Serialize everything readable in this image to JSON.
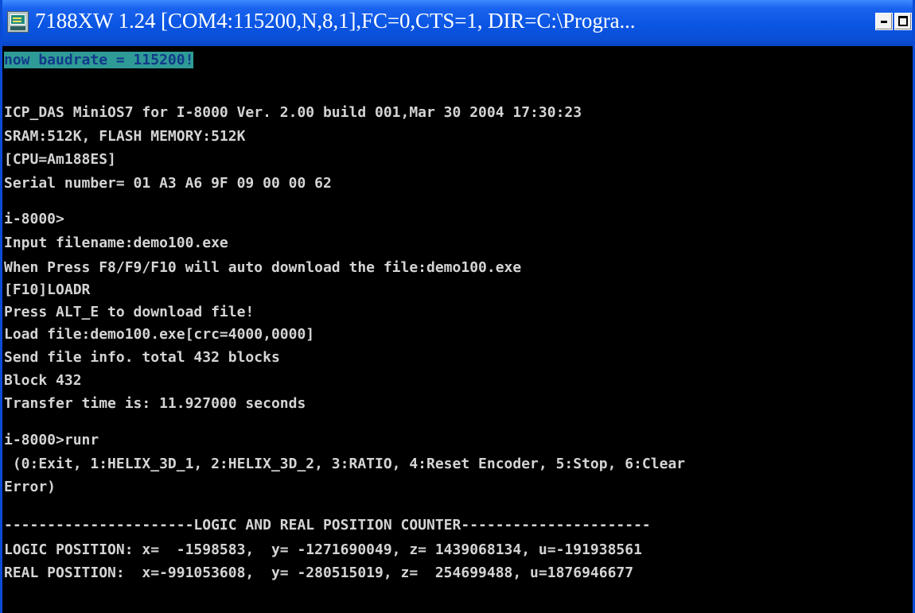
{
  "window": {
    "title": "7188XW 1.24 [COM4:115200,N,8,1],FC=0,CTS=1, DIR=C:\\Progra...",
    "icon": "terminal-app-icon",
    "buttons": {
      "minimize_icon": "minimize-icon",
      "maximize_icon": "maximize-icon"
    }
  },
  "colors": {
    "titlebar": "#0a55e3",
    "console_bg": "#000000",
    "console_text": "#d4d4d4",
    "highlight_bg": "#2f9b96",
    "highlight_text": "#123a8a"
  },
  "console": {
    "baud_line": "now baudrate = 115200!",
    "lines": [
      "ICP_DAS MiniOS7 for I-8000 Ver. 2.00 build 001,Mar 30 2004 17:30:23",
      "SRAM:512K, FLASH MEMORY:512K",
      "[CPU=Am188ES]",
      "Serial number= 01 A3 A6 9F 09 00 00 62",
      "i-8000>",
      "Input filename:demo100.exe",
      "When Press F8/F9/F10 will auto download the file:demo100.exe",
      "[F10]LOADR",
      "Press ALT_E to download file!",
      "Load file:demo100.exe[crc=4000,0000]",
      "Send file info. total 432 blocks",
      "Block 432",
      "Transfer time is: 11.927000 seconds",
      "i-8000>runr",
      " (0:Exit, 1:HELIX_3D_1, 2:HELIX_3D_2, 3:RATIO, 4:Reset Encoder, 5:Stop, 6:Clear",
      "Error)",
      "----------------------LOGIC AND REAL POSITION COUNTER----------------------",
      "LOGIC POSITION: x=  -1598583,  y= -1271690049, z= 1439068134, u=-191938561",
      "REAL POSITION:  x=-991053608,  y= -280515019, z=  254699488, u=1876946677"
    ]
  }
}
